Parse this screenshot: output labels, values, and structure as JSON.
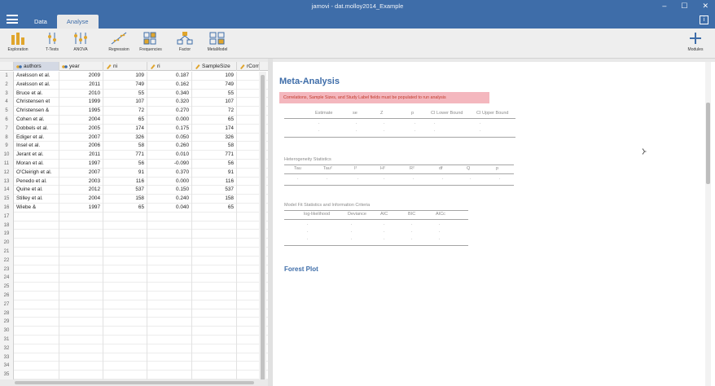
{
  "window": {
    "title": "jamovi - dat.molloy2014_Example",
    "buttons": [
      "–",
      "☐",
      "✕"
    ],
    "info_icon": "i"
  },
  "tabs": [
    {
      "label": "Data",
      "active": false
    },
    {
      "label": "Analyse",
      "active": true
    }
  ],
  "toolbar": {
    "items": [
      {
        "label": "Exploration",
        "icon": "bar-chart-icon"
      },
      {
        "label": "T-Tests",
        "icon": "t-test-icon"
      },
      {
        "label": "ANOVA",
        "icon": "anova-icon"
      },
      {
        "label": "Regression",
        "icon": "regression-icon"
      },
      {
        "label": "Frequencies",
        "icon": "frequencies-icon"
      },
      {
        "label": "Factor",
        "icon": "factor-icon"
      },
      {
        "label": "MetaModel",
        "icon": "metamodel-icon"
      }
    ],
    "modules_label": "Modules"
  },
  "sheet": {
    "columns": [
      {
        "name": "authors",
        "type": "nominal",
        "selected": true
      },
      {
        "name": "year",
        "type": "nominal"
      },
      {
        "name": "ni",
        "type": "continuous"
      },
      {
        "name": "ri",
        "type": "continuous"
      },
      {
        "name": "SampleSize",
        "type": "continuous"
      },
      {
        "name": "rCorr",
        "type": "continuous"
      }
    ],
    "rows": [
      [
        "Axelsson et al.",
        "2009",
        "109",
        "0.187",
        "109"
      ],
      [
        "Axelsson et al.",
        "2011",
        "749",
        "0.162",
        "749"
      ],
      [
        "Bruce et al.",
        "2010",
        "55",
        "0.340",
        "55"
      ],
      [
        "Christensen et",
        "1999",
        "107",
        "0.320",
        "107"
      ],
      [
        "Christensen &",
        "1995",
        "72",
        "0.270",
        "72"
      ],
      [
        "Cohen et al.",
        "2004",
        "65",
        "0.000",
        "65"
      ],
      [
        "Dobbels et al.",
        "2005",
        "174",
        "0.175",
        "174"
      ],
      [
        "Ediger et al.",
        "2007",
        "326",
        "0.050",
        "326"
      ],
      [
        "Insel et al.",
        "2006",
        "58",
        "0.260",
        "58"
      ],
      [
        "Jerant et al.",
        "2011",
        "771",
        "0.010",
        "771"
      ],
      [
        "Moran et al.",
        "1997",
        "56",
        "-0.090",
        "56"
      ],
      [
        "O'Cleirigh et al.",
        "2007",
        "91",
        "0.370",
        "91"
      ],
      [
        "Penedo et al.",
        "2003",
        "116",
        "0.000",
        "116"
      ],
      [
        "Quine et al.",
        "2012",
        "537",
        "0.150",
        "537"
      ],
      [
        "Stilley et al.",
        "2004",
        "158",
        "0.240",
        "158"
      ],
      [
        "Wiebe &",
        "1997",
        "65",
        "0.040",
        "65"
      ]
    ],
    "row_numbers": [
      "1",
      "2",
      "3",
      "4",
      "5",
      "6",
      "7",
      "8",
      "9",
      "10",
      "11",
      "12",
      "13",
      "14",
      "15",
      "16",
      "17",
      "18",
      "19",
      "20",
      "21",
      "22",
      "23",
      "24",
      "25",
      "26",
      "27",
      "28",
      "29",
      "30",
      "31",
      "32",
      "33",
      "34",
      "35"
    ]
  },
  "results": {
    "title": "Meta-Analysis",
    "error": "Correlations, Sample Sizes, and Study Label fields must be populated to run analysis",
    "main_table": {
      "headers": [
        "Estimate",
        "se",
        "Z",
        "p",
        "CI Lower Bound",
        "CI Upper Bound"
      ],
      "placeholder": "."
    },
    "heterogeneity": {
      "caption": "Heterogeneity Statistics",
      "headers": [
        "Tau",
        "Tau²",
        "I²",
        "H²",
        "R²",
        "df",
        "Q",
        "p"
      ],
      "placeholder": "."
    },
    "model_fit": {
      "caption": "Model Fit Statistics and Information Criteria",
      "headers": [
        "log-likelihood",
        "Deviance",
        "AIC",
        "BIC",
        "AICc"
      ],
      "placeholder": "."
    },
    "forest_title": "Forest Plot"
  },
  "colors": {
    "titlebar": "#3e6da9",
    "accent": "#3e6da9",
    "error_bg": "#f4b7be",
    "error_text": "#c0392b"
  }
}
